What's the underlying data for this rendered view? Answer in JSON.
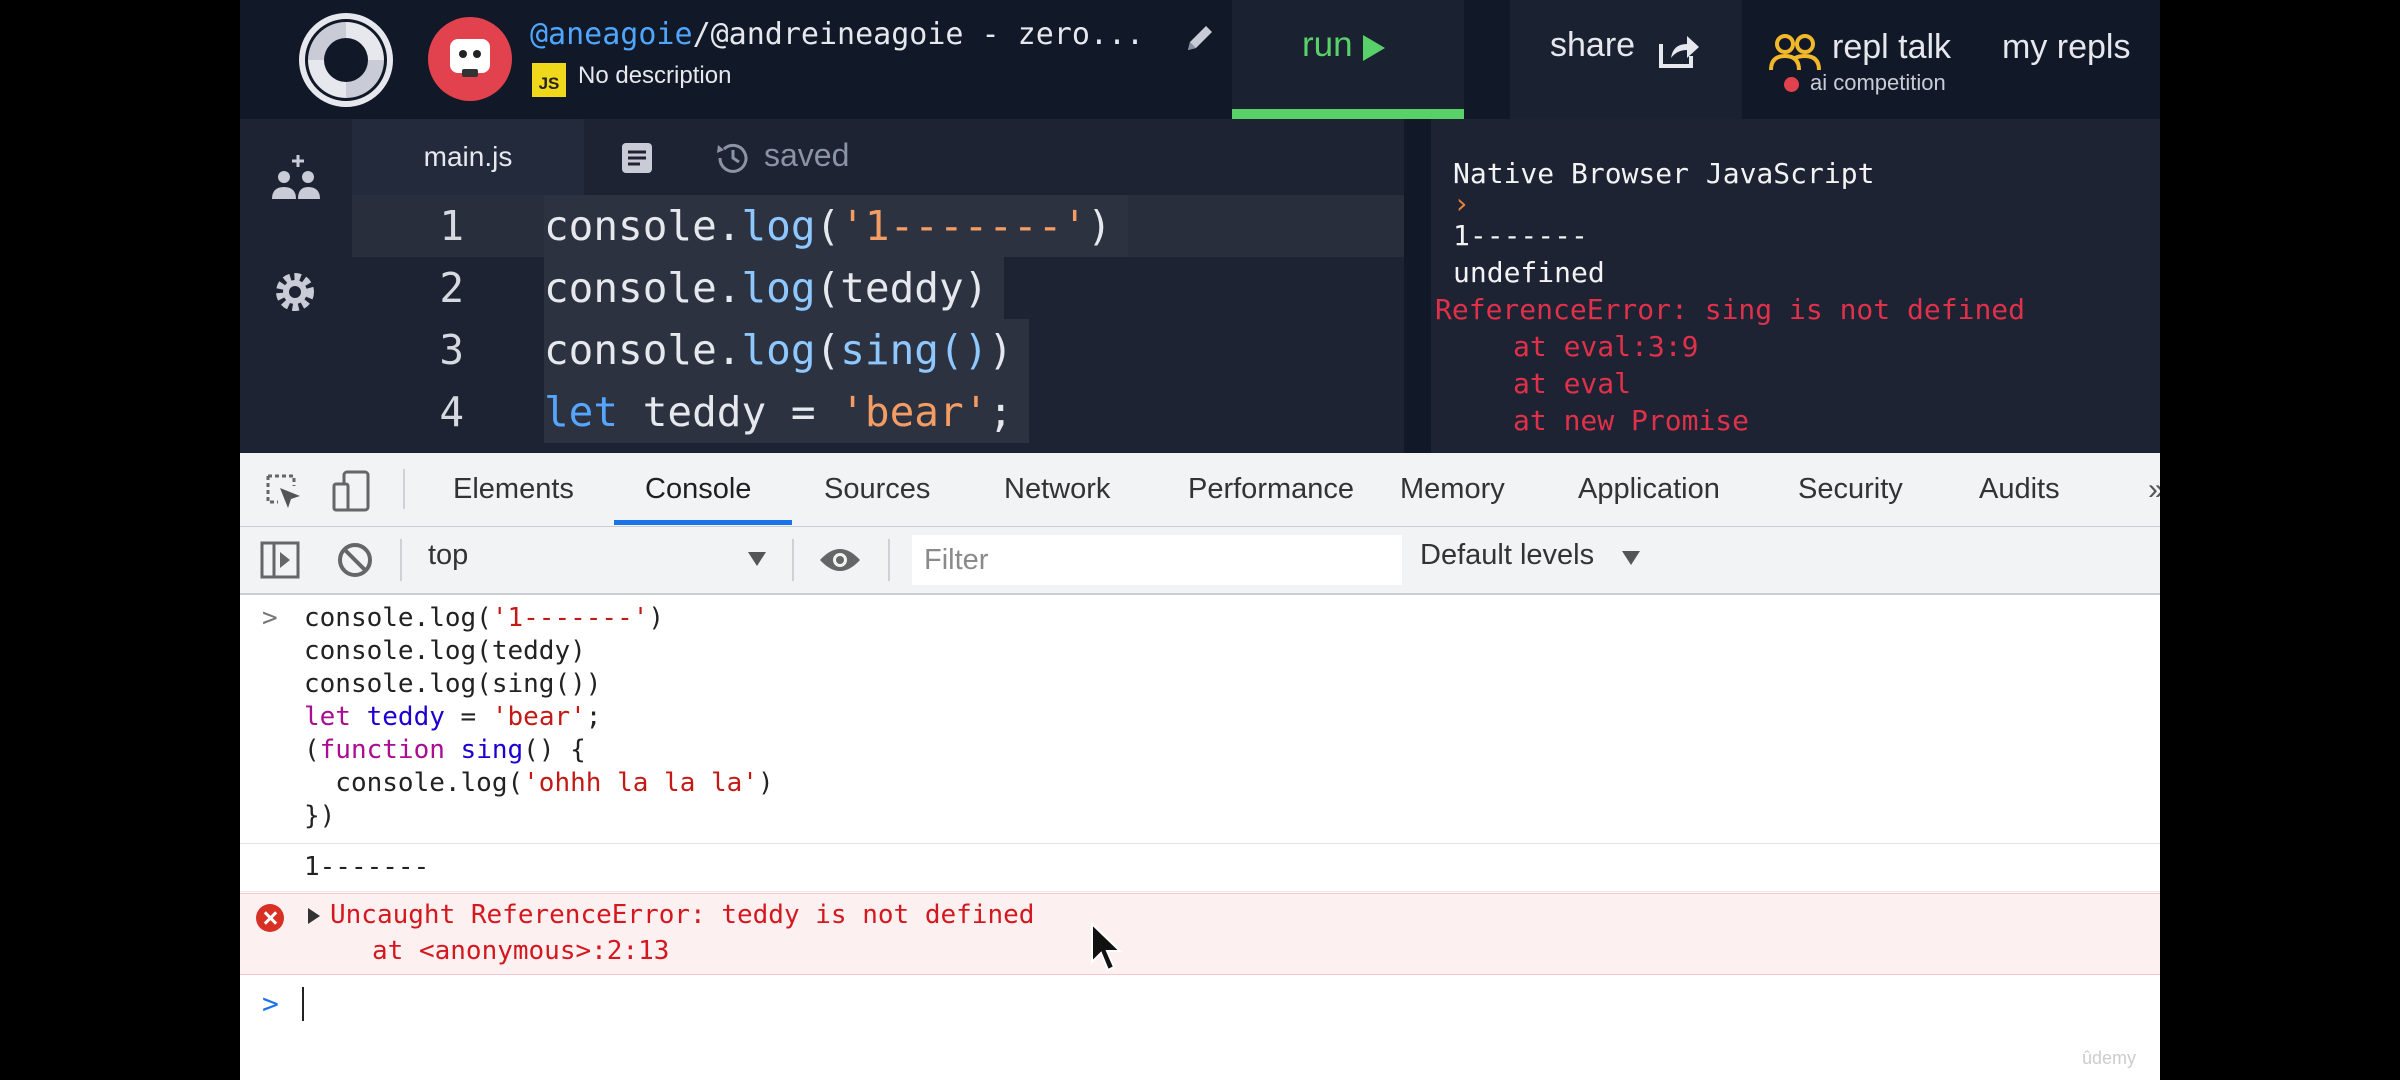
{
  "repl": {
    "title_user": "@aneagoie",
    "title_rest": "/@andreineagoie - zero...",
    "lang_badge": "JS",
    "description": "No description",
    "run_label": "run",
    "share_label": "share",
    "talk_label": "repl talk",
    "talk_sub": "ai competition",
    "my_repls": "my repls",
    "file_tab": "main.js",
    "saved": "saved"
  },
  "editor_lines": [
    {
      "num": "1",
      "a": "console.",
      "b": "log",
      "c": "(",
      "d": "'1-------'",
      "e": ")"
    },
    {
      "num": "2",
      "a": "console.",
      "b": "log",
      "c": "(teddy)",
      "d": "",
      "e": ""
    },
    {
      "num": "3",
      "a": "console.",
      "b": "log",
      "c": "(",
      "d": "sing()",
      "e": ")"
    },
    {
      "num": "4",
      "a": "let",
      "b": " teddy = ",
      "c": "'bear'",
      "d": ";",
      "e": ""
    }
  ],
  "repl_console": {
    "header": "Native Browser JavaScript",
    "prompt": "›",
    "line1": "1-------",
    "line2": "undefined",
    "err1": "ReferenceError: sing is not defined",
    "err2": "at eval:3:9",
    "err3": "at eval",
    "err4": "at new Promise"
  },
  "devtools": {
    "tabs": [
      "Elements",
      "Console",
      "Sources",
      "Network",
      "Performance",
      "Memory",
      "Application",
      "Security",
      "Audits"
    ],
    "context": "top",
    "filter_placeholder": "Filter",
    "levels": "Default levels",
    "input_chevron": ">",
    "input_code": [
      {
        "p1": "console.log(",
        "p2": "'1-------'",
        "p3": ")"
      },
      {
        "p1": "console.log(teddy)",
        "p2": "",
        "p3": ""
      },
      {
        "p1": "console.log(sing())",
        "p2": "",
        "p3": ""
      }
    ],
    "let_kw": "let",
    "let_var": " teddy",
    "let_eq": " = ",
    "let_str": "'bear'",
    "let_end": ";",
    "fn_open": "(",
    "fn_kw": "function",
    "fn_name": " sing",
    "fn_rest": "() {",
    "inner_pre": "  console.log(",
    "inner_str": "'ohhh la la la'",
    "inner_post": ")",
    "close": "})",
    "log_output": "1-------",
    "error_line1": "Uncaught ReferenceError: teddy is not defined",
    "error_line2": "at <anonymous>:2:13",
    "input_prompt": ">"
  },
  "watermark": "ûdemy",
  "colors": {
    "run_green": "#58d168",
    "error_red": "#d4181f",
    "accent_blue": "#1a73e8"
  }
}
